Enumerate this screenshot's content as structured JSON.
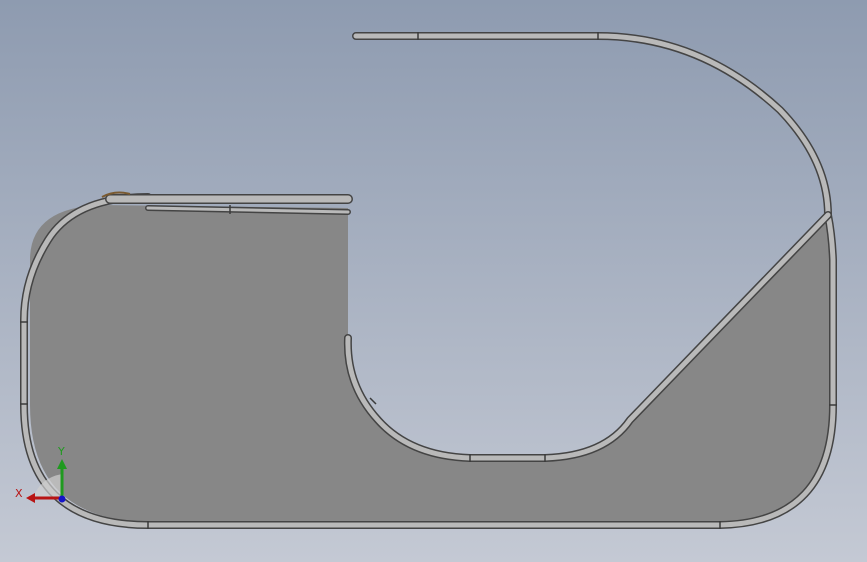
{
  "viewport": {
    "background_top": "#8e9bb0",
    "background_bottom": "#c4c9d4"
  },
  "model": {
    "plate_color": "#878787",
    "tube_color": "#b9b9b9",
    "tube_edge_color": "#444444"
  },
  "triad": {
    "x_label": "X",
    "y_label": "Y",
    "x_color": "#b81414",
    "y_color": "#1f9a1f",
    "z_color": "#1414c8"
  }
}
